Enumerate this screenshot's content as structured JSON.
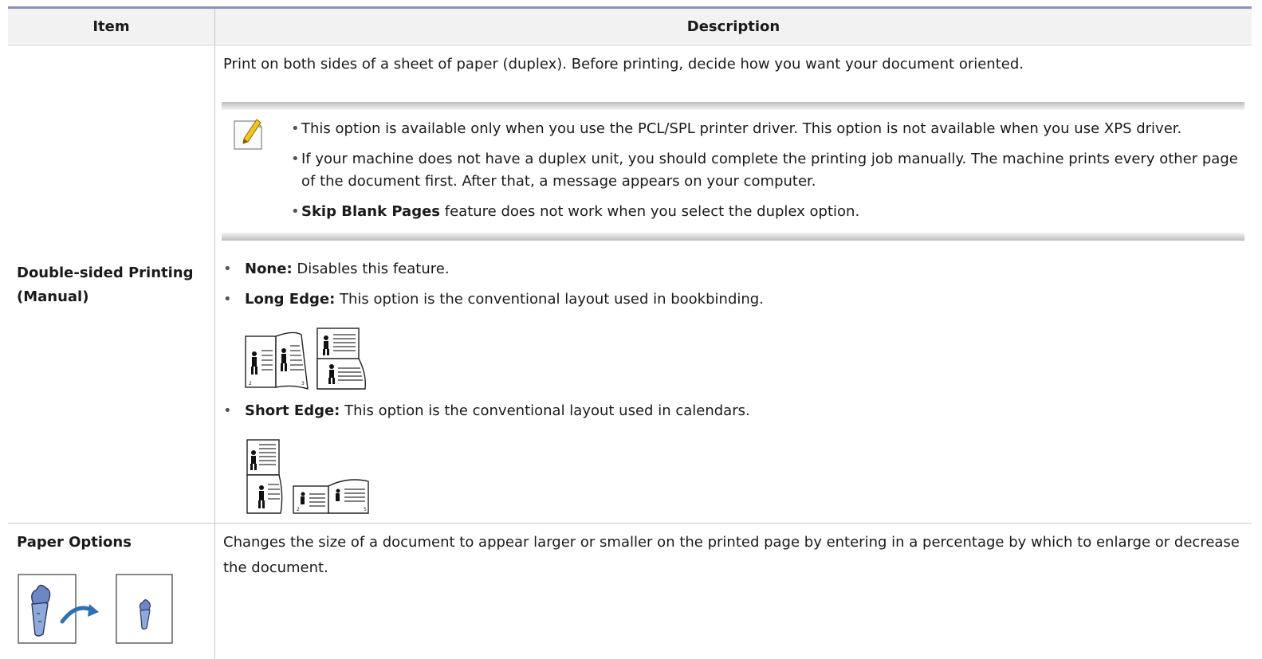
{
  "table": {
    "headers": {
      "item": "Item",
      "description": "Description"
    },
    "rows": [
      {
        "item_lines": [
          "Double-sided Printing",
          "(Manual)"
        ],
        "description": "Print on both sides of a sheet of paper (duplex). Before printing, decide how you want your document oriented.",
        "note_bullets": [
          "This option is available only when you use the PCL/SPL printer driver. This option is not available when you use XPS driver.",
          "If your machine does not have a duplex unit, you should complete the printing job manually. The machine prints every other page",
          "of the document first. After that, a message appears on your computer.",
          "Skip Blank Pages",
          "feature does not work when you select the duplex option."
        ],
        "options": [
          {
            "name": "None:",
            "text": "Disables this feature."
          },
          {
            "name": "Long Edge:",
            "text": "This option is the conventional layout used in bookbinding."
          },
          {
            "name": "Short Edge:",
            "text": "This option is the conventional layout used in calendars."
          }
        ],
        "figure_labels": {
          "page_a": "2",
          "page_b": "3",
          "page_c": "5"
        }
      },
      {
        "item": "Paper Options",
        "description_lines": [
          "Changes the size of a document to appear larger or smaller on the printed page by entering in a percentage by which to enlarge or decrease",
          "the document."
        ]
      }
    ]
  },
  "icons": {
    "note": "note-pencil-icon",
    "arrow": "curved-arrow-icon"
  },
  "colors": {
    "header_rule": "#8e8fb8",
    "arrow": "#2f6fb3",
    "carrot": "#8fa9d8"
  }
}
